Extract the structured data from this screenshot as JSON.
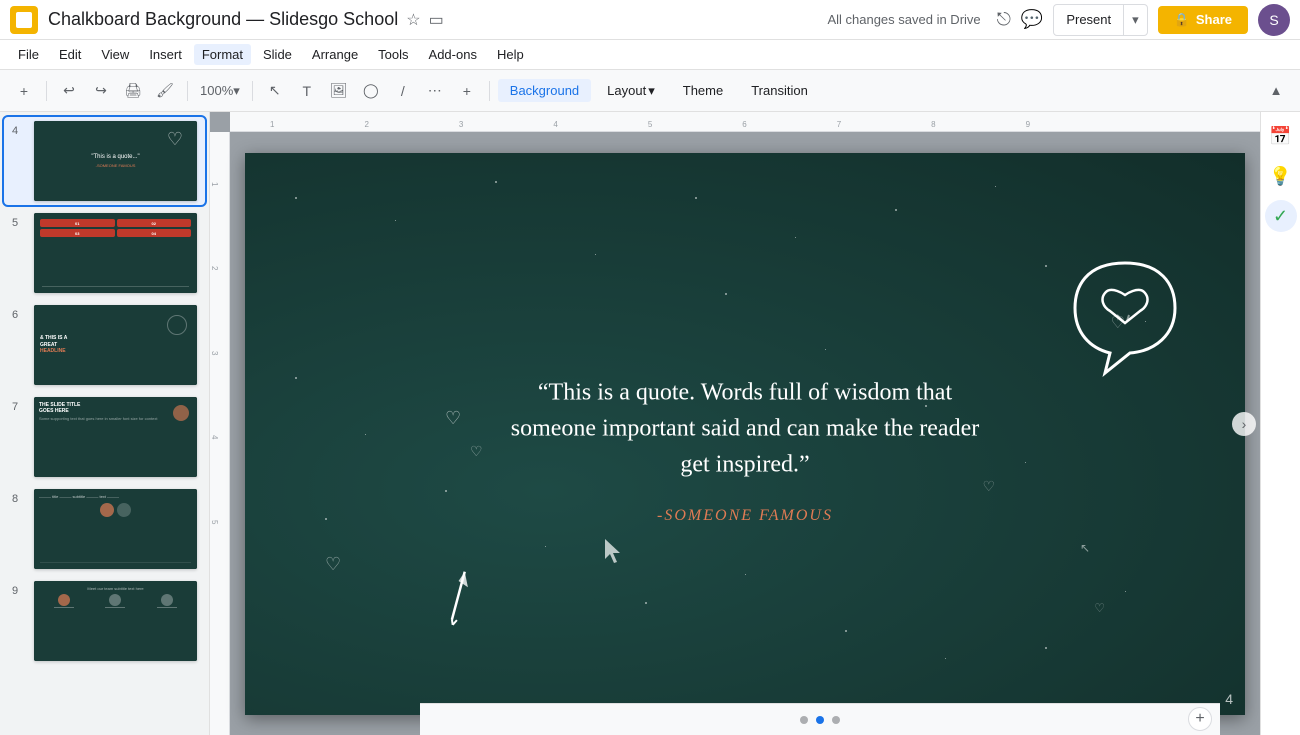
{
  "titleBar": {
    "appIcon": "slides-icon",
    "docTitle": "Chalkboard Background — Slidesgo School",
    "starLabel": "★",
    "folderLabel": "📁",
    "autosave": "All changes saved in Drive",
    "presentLabel": "Present",
    "shareLabel": "Share",
    "avatarInitial": "S"
  },
  "menuBar": {
    "items": [
      "File",
      "Edit",
      "View",
      "Insert",
      "Format",
      "Slide",
      "Arrange",
      "Tools",
      "Add-ons",
      "Help"
    ]
  },
  "toolbar": {
    "zoom": "100%",
    "backgroundLabel": "Background",
    "layoutLabel": "Layout",
    "themeLabel": "Theme",
    "transitionLabel": "Transition",
    "minimizeLabel": "▲"
  },
  "slidePanel": {
    "slides": [
      {
        "num": "4",
        "selected": true,
        "bg": "#1a3c38",
        "label": "Quote slide"
      },
      {
        "num": "5",
        "selected": false,
        "bg": "#1a3c38",
        "label": "Infographic slide"
      },
      {
        "num": "6",
        "selected": false,
        "bg": "#1a3c38",
        "label": "Headline slide"
      },
      {
        "num": "7",
        "selected": false,
        "bg": "#1a3c38",
        "label": "Content slide"
      },
      {
        "num": "8",
        "selected": false,
        "bg": "#1a3c38",
        "label": "Data slide"
      },
      {
        "num": "9",
        "selected": false,
        "bg": "#1a3c38",
        "label": "Team slide"
      }
    ]
  },
  "currentSlide": {
    "quoteText": "“This is a quote. Words full of wisdom that someone important said and can make the reader get inspired.”",
    "authorText": "-SOMEONE FAMOUS",
    "pageNum": "4"
  },
  "rightPanel": {
    "icons": [
      "calendar",
      "bulb",
      "checkCircle"
    ]
  },
  "bottomBar": {
    "dots": [
      1,
      2,
      3
    ],
    "activeDot": 2
  }
}
